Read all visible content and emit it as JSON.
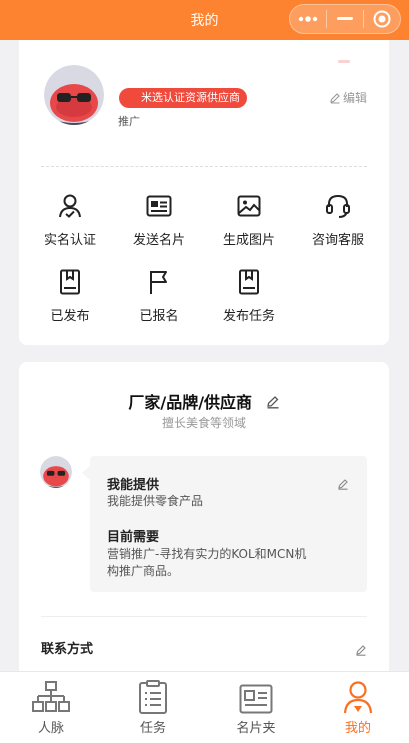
{
  "nav": {
    "title": "我的",
    "more_icon": "more-dots-icon",
    "minimize_icon": "minimize-icon",
    "close_icon": "target-close-icon"
  },
  "profile": {
    "badge": "米选认证资源供应商",
    "role": "推广",
    "edit_label": "编辑"
  },
  "actions": [
    {
      "label": "实名认证",
      "icon": "person-verify-icon"
    },
    {
      "label": "发送名片",
      "icon": "business-card-icon"
    },
    {
      "label": "生成图片",
      "icon": "image-icon"
    },
    {
      "label": "咨询客服",
      "icon": "headset-icon"
    },
    {
      "label": "已发布",
      "icon": "published-doc-icon"
    },
    {
      "label": "已报名",
      "icon": "flag-icon"
    },
    {
      "label": "发布任务",
      "icon": "task-doc-icon"
    }
  ],
  "supplier": {
    "title": "厂家/品牌/供应商",
    "subtitle": "擅长美食等领域",
    "can_offer_heading": "我能提供",
    "can_offer_text": "我能提供零食产品",
    "need_heading": "目前需要",
    "need_text_line1": "营销推广-寻找有实力的KOL和MCN机",
    "need_text_line2": "构推广商品。",
    "contact_heading": "联系方式"
  },
  "tabbar": [
    {
      "label": "人脉",
      "icon": "network-icon"
    },
    {
      "label": "任务",
      "icon": "task-list-icon"
    },
    {
      "label": "名片夹",
      "icon": "card-holder-icon"
    },
    {
      "label": "我的",
      "icon": "user-icon",
      "active": true
    }
  ],
  "colors": {
    "brand": "#fd8331",
    "badge": "#f04a3c",
    "active": "#fd6f1f"
  }
}
